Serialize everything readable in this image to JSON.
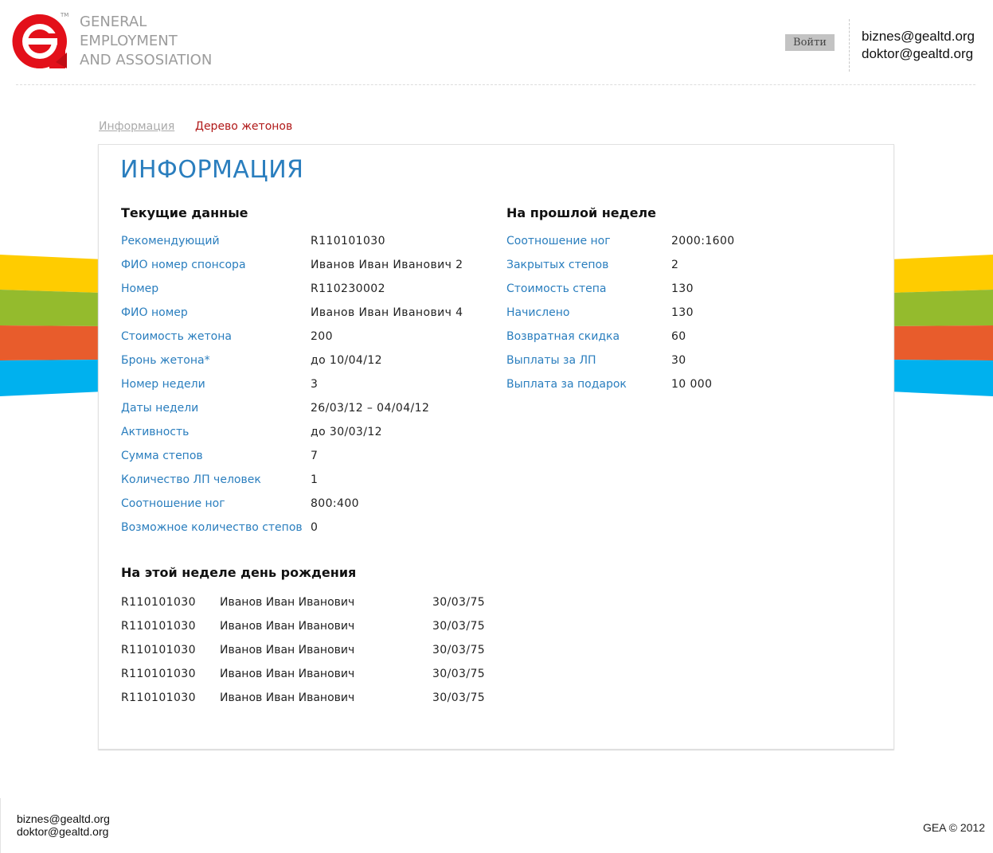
{
  "header": {
    "brand_lines": [
      "GENERAL",
      "EMPLOYMENT",
      "AND ASSOSIATION"
    ],
    "tm": "TM",
    "login_label": "Войти",
    "emails": [
      "biznes@gealtd.org",
      "doktor@gealtd.org"
    ]
  },
  "tabs": [
    {
      "label": "Информация"
    },
    {
      "label": "Дерево жетонов"
    }
  ],
  "info": {
    "title": "ИНФОРМАЦИЯ",
    "current": {
      "heading": "Текущие данные",
      "rows": [
        {
          "label": "Рекомендующий",
          "value": "R110101030"
        },
        {
          "label": "ФИО номер спонсора",
          "value": "Иванов Иван Иванович 2"
        },
        {
          "label": "Номер",
          "value": "R110230002"
        },
        {
          "label": "ФИО номер",
          "value": "Иванов Иван Иванович 4"
        },
        {
          "label": "Стоимость жетона",
          "value": "200"
        },
        {
          "label": "Бронь жетона*",
          "value": "до 10/04/12"
        },
        {
          "label": "Номер недели",
          "value": "3"
        },
        {
          "label": "Даты недели",
          "value": "26/03/12 – 04/04/12"
        },
        {
          "label": "Активность",
          "value": "до 30/03/12"
        },
        {
          "label": "Сумма степов",
          "value": "7"
        },
        {
          "label": "Количество ЛП человек",
          "value": "1"
        },
        {
          "label": "Соотношение ног",
          "value": "800:400"
        },
        {
          "label": "Возможное количество степов",
          "value": "0"
        }
      ]
    },
    "last_week": {
      "heading": "На прошлой неделе",
      "rows": [
        {
          "label": "Соотношение ног",
          "value": "2000:1600"
        },
        {
          "label": "Закрытых степов",
          "value": "2"
        },
        {
          "label": "Стоимость степа",
          "value": "130"
        },
        {
          "label": "Начислено",
          "value": "130"
        },
        {
          "label": "Возвратная скидка",
          "value": "60"
        },
        {
          "label": "Выплаты за ЛП",
          "value": "30"
        },
        {
          "label": "Выплата за подарок",
          "value": "10 000"
        }
      ]
    },
    "birthdays": {
      "heading": "На этой неделе день рождения",
      "rows": [
        {
          "id": "R110101030",
          "name": "Иванов Иван Иванович",
          "date": "30/03/75"
        },
        {
          "id": "R110101030",
          "name": "Иванов Иван Иванович",
          "date": "30/03/75"
        },
        {
          "id": "R110101030",
          "name": "Иванов Иван Иванович",
          "date": "30/03/75"
        },
        {
          "id": "R110101030",
          "name": "Иванов Иван Иванович",
          "date": "30/03/75"
        },
        {
          "id": "R110101030",
          "name": "Иванов Иван Иванович",
          "date": "30/03/75"
        }
      ]
    }
  },
  "footer": {
    "emails": [
      "biznes@gealtd.org",
      "doktor@gealtd.org"
    ],
    "copyright": "GEA © 2012"
  },
  "colors": {
    "accent_blue": "#2a7ebe",
    "tab_red": "#b01818",
    "logo_red": "#e3101a",
    "stripe_yellow": "#ffcc00",
    "stripe_green": "#94bb2d",
    "stripe_orange": "#e85c2c",
    "stripe_blue": "#00b1ee"
  }
}
